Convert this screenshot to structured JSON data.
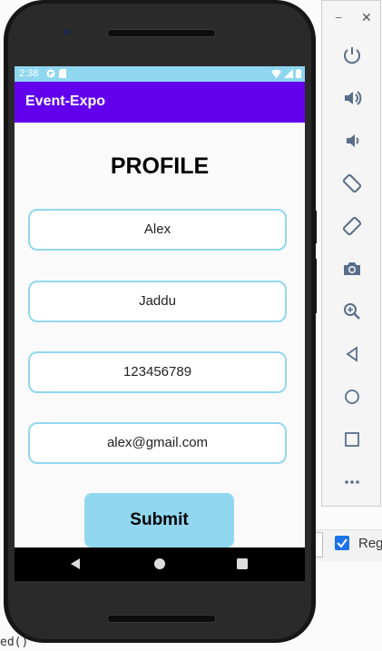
{
  "emulator": {
    "toolbar": {
      "minimize_label": "−",
      "close_label": "✕",
      "buttons": [
        {
          "icon": "power-icon"
        },
        {
          "icon": "volume-up-icon"
        },
        {
          "icon": "volume-down-icon"
        },
        {
          "icon": "rotate-left-icon"
        },
        {
          "icon": "rotate-right-icon"
        },
        {
          "icon": "camera-icon"
        },
        {
          "icon": "zoom-icon"
        },
        {
          "icon": "back-icon"
        },
        {
          "icon": "home-icon"
        },
        {
          "icon": "overview-icon"
        },
        {
          "icon": "more-icon"
        }
      ]
    }
  },
  "ide": {
    "checkbox_label": "Reg",
    "code_text": "ed()"
  },
  "statusbar": {
    "time": "2:38"
  },
  "app": {
    "title": "Event-Expo",
    "heading": "PROFILE",
    "fields": {
      "first_name": "Alex",
      "last_name": "Jaddu",
      "phone": "123456789",
      "email": "alex@gmail.com"
    },
    "submit_label": "Submit"
  },
  "colors": {
    "app_bar": "#6200ee",
    "status_bar": "#8fd6f0",
    "accent": "#92d7f0"
  }
}
